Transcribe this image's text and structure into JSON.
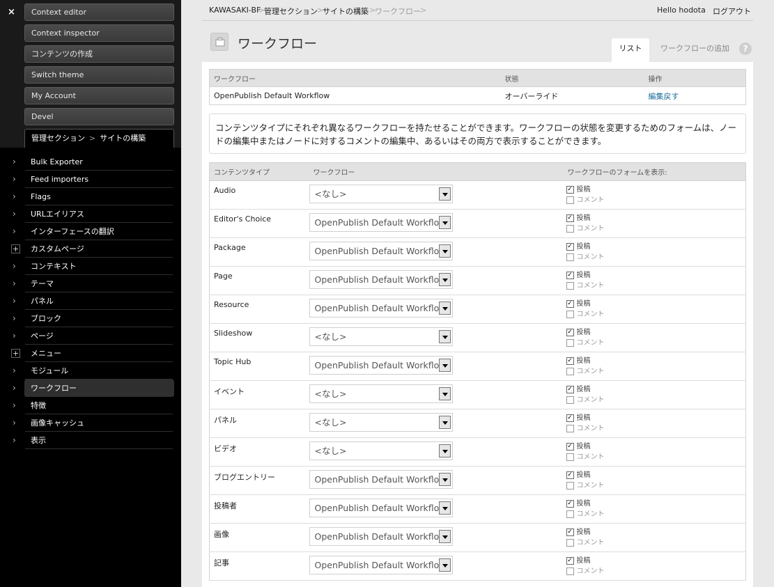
{
  "sidebar": {
    "close": "×",
    "tools": [
      "Context editor",
      "Context inspector",
      "コンテンツの作成",
      "Switch theme",
      "My Account",
      "Devel"
    ],
    "breadcrumb": {
      "part1": "管理セクション",
      "sep": ">",
      "part2": "サイトの構築"
    },
    "menu": [
      {
        "label": "Bulk Exporter",
        "icon": "chevron-right-icon"
      },
      {
        "label": "Feed importers",
        "icon": "chevron-right-icon"
      },
      {
        "label": "Flags",
        "icon": "chevron-right-icon"
      },
      {
        "label": "URLエイリアス",
        "icon": "chevron-right-icon"
      },
      {
        "label": "インターフェースの翻訳",
        "icon": "chevron-right-icon"
      },
      {
        "label": "カスタムページ",
        "icon": "plus-icon"
      },
      {
        "label": "コンテキスト",
        "icon": "chevron-right-icon"
      },
      {
        "label": "テーマ",
        "icon": "chevron-right-icon"
      },
      {
        "label": "パネル",
        "icon": "chevron-right-icon"
      },
      {
        "label": "ブロック",
        "icon": "chevron-right-icon"
      },
      {
        "label": "ページ",
        "icon": "chevron-right-icon"
      },
      {
        "label": "メニュー",
        "icon": "plus-icon"
      },
      {
        "label": "モジュール",
        "icon": "chevron-right-icon"
      },
      {
        "label": "ワークフロー",
        "icon": "chevron-right-icon",
        "active": true
      },
      {
        "label": "特徴",
        "icon": "chevron-right-icon"
      },
      {
        "label": "画像キャッシュ",
        "icon": "chevron-right-icon"
      },
      {
        "label": "表示",
        "icon": "chevron-right-icon"
      }
    ]
  },
  "topbar": {
    "breadcrumbs": [
      "KAWASAKI-BF",
      "管理セクション",
      "サイトの構築",
      "ワークフロー"
    ],
    "sep": ">",
    "greeting": "Hello hodota",
    "logout": "ログアウト"
  },
  "page": {
    "title": "ワークフロー",
    "tabs": {
      "list": "リスト",
      "add": "ワークフローの追加"
    },
    "help": "?"
  },
  "workflows": {
    "headers": [
      "ワークフロー",
      "状態",
      "操作"
    ],
    "rows": [
      {
        "name": "OpenPublish Default Workflow",
        "status": "オーバーライド",
        "action": "編集戻す"
      }
    ]
  },
  "description": "コンテンツタイプにそれぞれ異なるワークフローを持たせることができます。ワークフローの状態を変更するためのフォームは、ノードの編集中またはノードに対するコメントの編集中、あるいはその両方で表示することができます。",
  "content_types": {
    "headers": [
      "コンテンツタイプ",
      "ワークフロー",
      "ワークフローのフォームを表示:"
    ],
    "option_labels": {
      "post": "投稿",
      "comment": "コメント"
    },
    "rows": [
      {
        "type": "Audio",
        "workflow": "<なし>",
        "post": true,
        "comment": false
      },
      {
        "type": "Editor's Choice",
        "workflow": "OpenPublish Default Workflow",
        "post": true,
        "comment": false
      },
      {
        "type": "Package",
        "workflow": "OpenPublish Default Workflow",
        "post": true,
        "comment": false
      },
      {
        "type": "Page",
        "workflow": "OpenPublish Default Workflow",
        "post": true,
        "comment": false
      },
      {
        "type": "Resource",
        "workflow": "OpenPublish Default Workflow",
        "post": true,
        "comment": false
      },
      {
        "type": "Slideshow",
        "workflow": "<なし>",
        "post": true,
        "comment": false
      },
      {
        "type": "Topic Hub",
        "workflow": "OpenPublish Default Workflow",
        "post": true,
        "comment": false
      },
      {
        "type": "イベント",
        "workflow": "<なし>",
        "post": true,
        "comment": false
      },
      {
        "type": "パネル",
        "workflow": "<なし>",
        "post": true,
        "comment": false
      },
      {
        "type": "ビデオ",
        "workflow": "<なし>",
        "post": true,
        "comment": false
      },
      {
        "type": "ブログエントリー",
        "workflow": "OpenPublish Default Workflow",
        "post": true,
        "comment": false
      },
      {
        "type": "投稿者",
        "workflow": "OpenPublish Default Workflow",
        "post": true,
        "comment": false
      },
      {
        "type": "画像",
        "workflow": "OpenPublish Default Workflow",
        "post": true,
        "comment": false
      },
      {
        "type": "記事",
        "workflow": "OpenPublish Default Workflow",
        "post": true,
        "comment": false
      }
    ]
  }
}
